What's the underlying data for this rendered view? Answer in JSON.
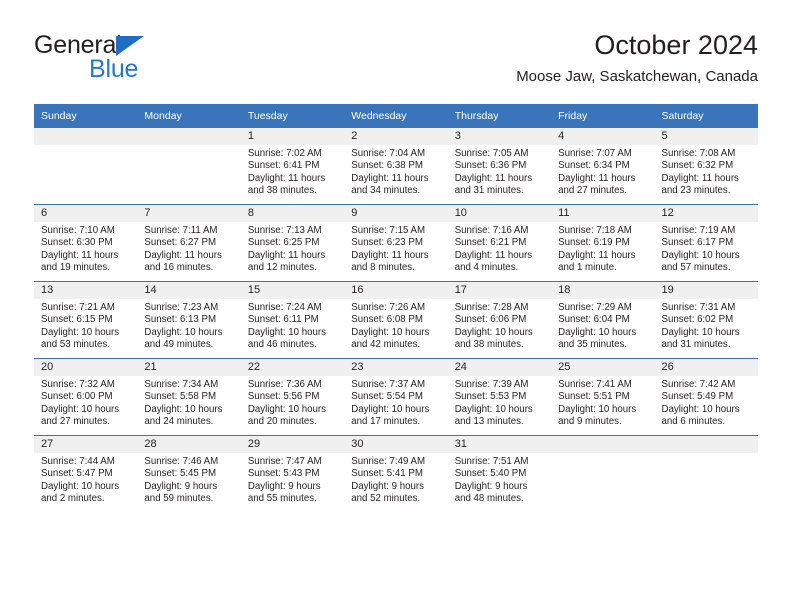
{
  "logo": {
    "word_top": "General",
    "word_bottom": "Blue",
    "triangle_icon": "triangle-icon",
    "color_dark": "#231f20",
    "color_blue": "#1f7ad4"
  },
  "header": {
    "title": "October 2024",
    "subtitle": "Moose Jaw, Saskatchewan, Canada",
    "accent_color": "#3a74ba"
  },
  "calendar": {
    "weekday_headers": [
      "Sunday",
      "Monday",
      "Tuesday",
      "Wednesday",
      "Thursday",
      "Friday",
      "Saturday"
    ],
    "labels": {
      "sunrise": "Sunrise:",
      "sunset": "Sunset:",
      "daylight": "Daylight:"
    },
    "weeks": [
      [
        {
          "day": "",
          "sunrise": "",
          "sunset": "",
          "daylight": "",
          "empty": true
        },
        {
          "day": "",
          "sunrise": "",
          "sunset": "",
          "daylight": "",
          "empty": true
        },
        {
          "day": "1",
          "sunrise": "Sunrise: 7:02 AM",
          "sunset": "Sunset: 6:41 PM",
          "daylight": "Daylight: 11 hours and 38 minutes."
        },
        {
          "day": "2",
          "sunrise": "Sunrise: 7:04 AM",
          "sunset": "Sunset: 6:38 PM",
          "daylight": "Daylight: 11 hours and 34 minutes."
        },
        {
          "day": "3",
          "sunrise": "Sunrise: 7:05 AM",
          "sunset": "Sunset: 6:36 PM",
          "daylight": "Daylight: 11 hours and 31 minutes."
        },
        {
          "day": "4",
          "sunrise": "Sunrise: 7:07 AM",
          "sunset": "Sunset: 6:34 PM",
          "daylight": "Daylight: 11 hours and 27 minutes."
        },
        {
          "day": "5",
          "sunrise": "Sunrise: 7:08 AM",
          "sunset": "Sunset: 6:32 PM",
          "daylight": "Daylight: 11 hours and 23 minutes."
        }
      ],
      [
        {
          "day": "6",
          "sunrise": "Sunrise: 7:10 AM",
          "sunset": "Sunset: 6:30 PM",
          "daylight": "Daylight: 11 hours and 19 minutes."
        },
        {
          "day": "7",
          "sunrise": "Sunrise: 7:11 AM",
          "sunset": "Sunset: 6:27 PM",
          "daylight": "Daylight: 11 hours and 16 minutes."
        },
        {
          "day": "8",
          "sunrise": "Sunrise: 7:13 AM",
          "sunset": "Sunset: 6:25 PM",
          "daylight": "Daylight: 11 hours and 12 minutes."
        },
        {
          "day": "9",
          "sunrise": "Sunrise: 7:15 AM",
          "sunset": "Sunset: 6:23 PM",
          "daylight": "Daylight: 11 hours and 8 minutes."
        },
        {
          "day": "10",
          "sunrise": "Sunrise: 7:16 AM",
          "sunset": "Sunset: 6:21 PM",
          "daylight": "Daylight: 11 hours and 4 minutes."
        },
        {
          "day": "11",
          "sunrise": "Sunrise: 7:18 AM",
          "sunset": "Sunset: 6:19 PM",
          "daylight": "Daylight: 11 hours and 1 minute."
        },
        {
          "day": "12",
          "sunrise": "Sunrise: 7:19 AM",
          "sunset": "Sunset: 6:17 PM",
          "daylight": "Daylight: 10 hours and 57 minutes."
        }
      ],
      [
        {
          "day": "13",
          "sunrise": "Sunrise: 7:21 AM",
          "sunset": "Sunset: 6:15 PM",
          "daylight": "Daylight: 10 hours and 53 minutes."
        },
        {
          "day": "14",
          "sunrise": "Sunrise: 7:23 AM",
          "sunset": "Sunset: 6:13 PM",
          "daylight": "Daylight: 10 hours and 49 minutes."
        },
        {
          "day": "15",
          "sunrise": "Sunrise: 7:24 AM",
          "sunset": "Sunset: 6:11 PM",
          "daylight": "Daylight: 10 hours and 46 minutes."
        },
        {
          "day": "16",
          "sunrise": "Sunrise: 7:26 AM",
          "sunset": "Sunset: 6:08 PM",
          "daylight": "Daylight: 10 hours and 42 minutes."
        },
        {
          "day": "17",
          "sunrise": "Sunrise: 7:28 AM",
          "sunset": "Sunset: 6:06 PM",
          "daylight": "Daylight: 10 hours and 38 minutes."
        },
        {
          "day": "18",
          "sunrise": "Sunrise: 7:29 AM",
          "sunset": "Sunset: 6:04 PM",
          "daylight": "Daylight: 10 hours and 35 minutes."
        },
        {
          "day": "19",
          "sunrise": "Sunrise: 7:31 AM",
          "sunset": "Sunset: 6:02 PM",
          "daylight": "Daylight: 10 hours and 31 minutes."
        }
      ],
      [
        {
          "day": "20",
          "sunrise": "Sunrise: 7:32 AM",
          "sunset": "Sunset: 6:00 PM",
          "daylight": "Daylight: 10 hours and 27 minutes."
        },
        {
          "day": "21",
          "sunrise": "Sunrise: 7:34 AM",
          "sunset": "Sunset: 5:58 PM",
          "daylight": "Daylight: 10 hours and 24 minutes."
        },
        {
          "day": "22",
          "sunrise": "Sunrise: 7:36 AM",
          "sunset": "Sunset: 5:56 PM",
          "daylight": "Daylight: 10 hours and 20 minutes."
        },
        {
          "day": "23",
          "sunrise": "Sunrise: 7:37 AM",
          "sunset": "Sunset: 5:54 PM",
          "daylight": "Daylight: 10 hours and 17 minutes."
        },
        {
          "day": "24",
          "sunrise": "Sunrise: 7:39 AM",
          "sunset": "Sunset: 5:53 PM",
          "daylight": "Daylight: 10 hours and 13 minutes."
        },
        {
          "day": "25",
          "sunrise": "Sunrise: 7:41 AM",
          "sunset": "Sunset: 5:51 PM",
          "daylight": "Daylight: 10 hours and 9 minutes."
        },
        {
          "day": "26",
          "sunrise": "Sunrise: 7:42 AM",
          "sunset": "Sunset: 5:49 PM",
          "daylight": "Daylight: 10 hours and 6 minutes."
        }
      ],
      [
        {
          "day": "27",
          "sunrise": "Sunrise: 7:44 AM",
          "sunset": "Sunset: 5:47 PM",
          "daylight": "Daylight: 10 hours and 2 minutes."
        },
        {
          "day": "28",
          "sunrise": "Sunrise: 7:46 AM",
          "sunset": "Sunset: 5:45 PM",
          "daylight": "Daylight: 9 hours and 59 minutes."
        },
        {
          "day": "29",
          "sunrise": "Sunrise: 7:47 AM",
          "sunset": "Sunset: 5:43 PM",
          "daylight": "Daylight: 9 hours and 55 minutes."
        },
        {
          "day": "30",
          "sunrise": "Sunrise: 7:49 AM",
          "sunset": "Sunset: 5:41 PM",
          "daylight": "Daylight: 9 hours and 52 minutes."
        },
        {
          "day": "31",
          "sunrise": "Sunrise: 7:51 AM",
          "sunset": "Sunset: 5:40 PM",
          "daylight": "Daylight: 9 hours and 48 minutes."
        },
        {
          "day": "",
          "sunrise": "",
          "sunset": "",
          "daylight": "",
          "empty": true
        },
        {
          "day": "",
          "sunrise": "",
          "sunset": "",
          "daylight": "",
          "empty": true
        }
      ]
    ]
  }
}
